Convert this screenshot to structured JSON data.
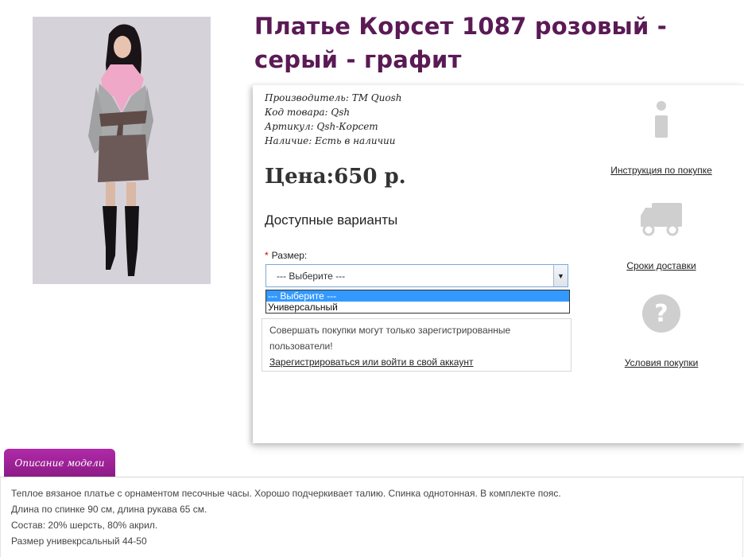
{
  "product": {
    "title": "Платье Корсет 1087 розовый - серый - графит",
    "meta": [
      {
        "key": "Производитель:",
        "value": " ТМ Quosh"
      },
      {
        "key": "Код товара:",
        "value": " Qsh"
      },
      {
        "key": "Артикул:",
        "value": " Qsh-Корсет"
      },
      {
        "key": "Наличие:",
        "value": " Есть в наличии"
      }
    ],
    "price": "Цена:650 р.",
    "variants_title": "Доступные варианты",
    "size_required_mark": "*",
    "size_label": "Размер:",
    "size_select_value": "--- Выберите ---",
    "size_options": [
      "--- Выберите ---",
      "Универсальный"
    ],
    "notice_text": "Совершать покупки могут только зарегистрированные пользователи!",
    "notice_link": "Зарегистрироваться или войти в свой аккаунт"
  },
  "side": {
    "instruction_label": "Инструкция по покупке",
    "delivery_label": "Сроки доставки",
    "terms_label": "Условия покупки",
    "icons": [
      "info-icon",
      "truck-icon",
      "question-icon"
    ]
  },
  "tabs": {
    "description_label": "Описание модели"
  },
  "description": [
    "Теплое вязаное платье с орнаментом песочные часы. Хорошо подчеркивает талию. Спинка однотонная. В комплекте пояс.",
    "Длина по спинке 90 см, длина рукава 65 см.",
    "Состав: 20% шерсть, 80% акрил.",
    "Размер унивекрсальный 44-50"
  ],
  "colors": {
    "title": "#5a1a55",
    "tab": "#a2249b",
    "selected_option": "#3399ff",
    "icon_gray": "#cfcfcf"
  }
}
